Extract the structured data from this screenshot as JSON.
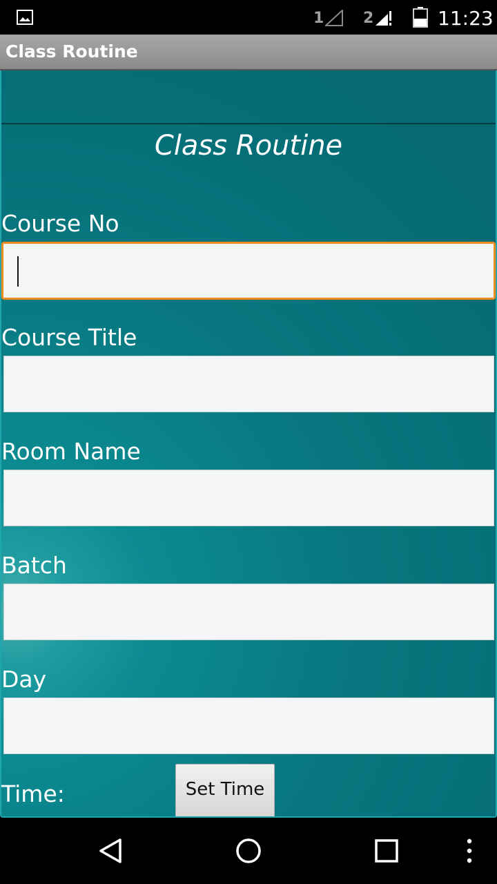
{
  "status_bar": {
    "sim1_label": "1",
    "sim2_label": "2",
    "time": "11:23",
    "icons": [
      "gallery-icon",
      "signal-sim1-icon",
      "signal-sim2-no-data-icon",
      "battery-icon"
    ]
  },
  "action_bar": {
    "title": "Class Routine"
  },
  "form": {
    "title": "Class Routine",
    "fields": [
      {
        "label": "Course No",
        "value": "",
        "focused": true
      },
      {
        "label": "Course Title",
        "value": ""
      },
      {
        "label": "Room Name",
        "value": ""
      },
      {
        "label": "Batch",
        "value": ""
      },
      {
        "label": "Day",
        "value": ""
      }
    ],
    "time_label": "Time:",
    "set_time_label": "Set Time"
  },
  "nav_bar": {
    "icons": [
      "back-icon",
      "home-icon",
      "recents-icon",
      "overflow-menu-icon"
    ]
  },
  "colors": {
    "background_teal": "#056a73",
    "focus_border": "#f08c1c",
    "input_background": "#f3f5f6",
    "action_bar": "#9a9a9a"
  }
}
